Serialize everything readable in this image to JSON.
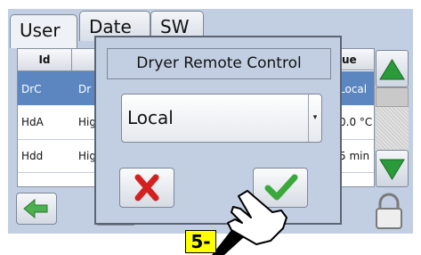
{
  "tabs": [
    {
      "label": "User",
      "active": true
    },
    {
      "label": "Date",
      "active": false
    },
    {
      "label": "SW",
      "active": false
    }
  ],
  "table": {
    "headers": [
      "Id",
      "",
      "",
      "ue"
    ],
    "rows": [
      {
        "id": "DrC",
        "name": "Dr",
        "value": "Local",
        "selected": true
      },
      {
        "id": "HdA",
        "name": "Hig",
        "value": "0.0 °C",
        "selected": false
      },
      {
        "id": "Hdd",
        "name": "Hig",
        "value": "5 min",
        "selected": false
      }
    ]
  },
  "dialog": {
    "title": "Dryer Remote Control",
    "selected_option": "Local"
  },
  "step_label": "5-",
  "colors": {
    "background": "#c2cfe3",
    "selected_row": "#5b86c0",
    "scroll_arrow": "#2a9a3a",
    "cancel_icon": "#d42020",
    "ok_icon": "#3aa83a",
    "step_label_bg": "#ffff00"
  }
}
